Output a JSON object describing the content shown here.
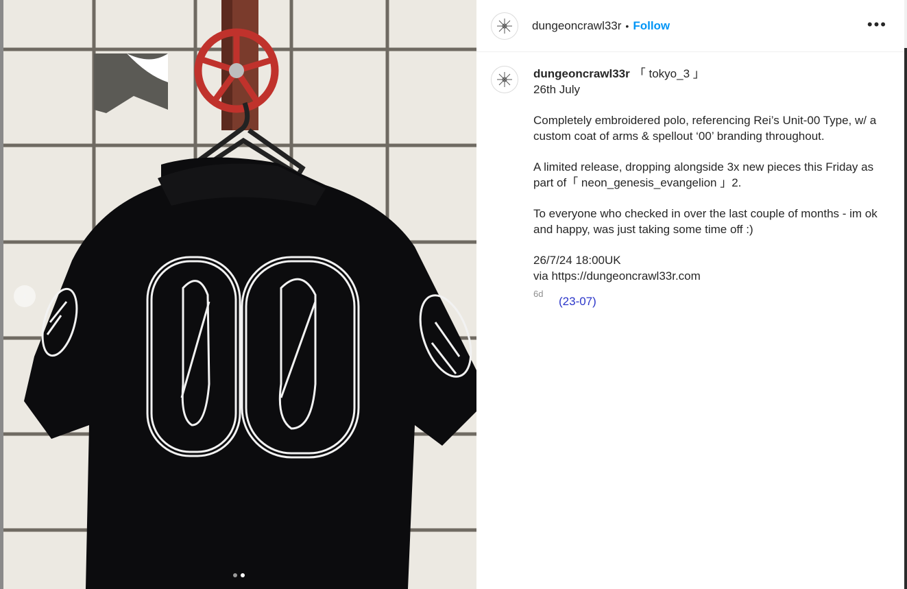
{
  "post": {
    "username": "dungeoncrawl33r",
    "follow_label": "Follow",
    "separator": "•",
    "more_label": "•••"
  },
  "caption": {
    "username": "dungeoncrawl33r",
    "tag": "「 tokyo_3 」",
    "date_line": "26th July",
    "paragraph_1": "Completely embroidered polo, referencing Rei’s Unit-00 Type, w/ a custom coat of arms & spellout ‘00’ branding throughout.",
    "paragraph_2": "A limited release, dropping alongside 3x new pieces this Friday as part of「 neon_genesis_evangelion 」2.",
    "paragraph_3": "To everyone who checked in over the last couple of months - im ok and happy, was just taking some time off :)",
    "release_line": "26/7/24 18:00UK",
    "via_line": "via https://dungeoncrawl33r.com",
    "time_ago": "6d",
    "date_link": "(23-07)"
  },
  "carousel": {
    "prev_icon": "‹",
    "total_slides": 2,
    "active_slide": 2
  },
  "icons": {
    "avatar": "snowflake-logo-icon",
    "carousel_prev": "chevron-left-icon",
    "more": "more-horizontal-icon"
  },
  "colors": {
    "follow": "#0095f6",
    "link": "#2a35c9",
    "shirt": "#0c0c0e",
    "embroidery": "#f2f2f2"
  }
}
